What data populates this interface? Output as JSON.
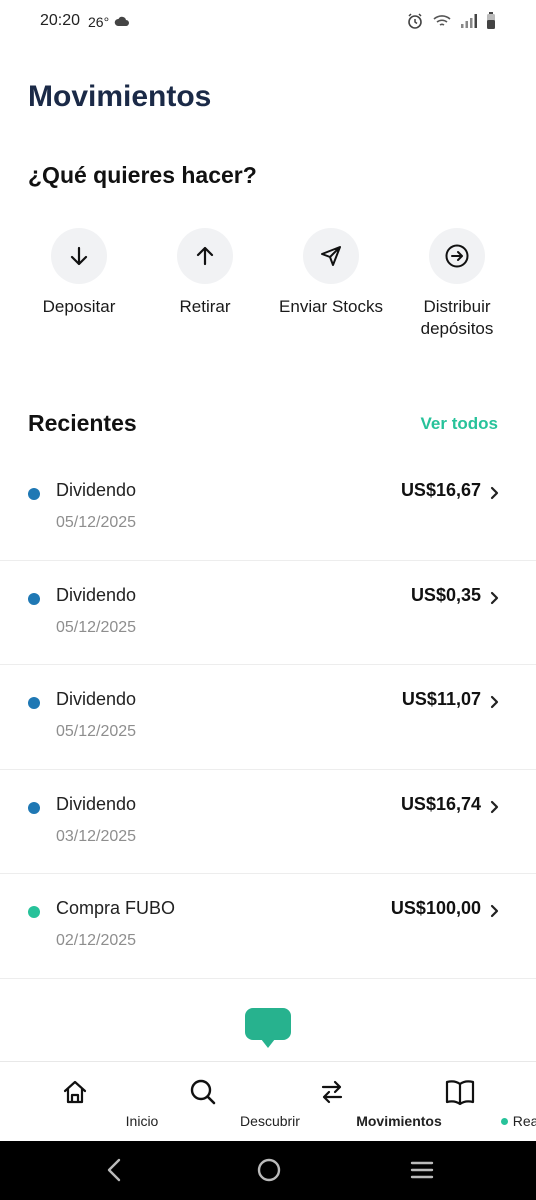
{
  "status_bar": {
    "time": "20:20",
    "temperature": "26°"
  },
  "page": {
    "title": "Movimientos",
    "question": "¿Qué quieres hacer?"
  },
  "actions": [
    {
      "label": "Depositar",
      "icon": "arrow-down-icon"
    },
    {
      "label": "Retirar",
      "icon": "arrow-up-icon"
    },
    {
      "label": "Enviar Stocks",
      "icon": "send-icon"
    },
    {
      "label": "Distribuir depósitos",
      "icon": "arrow-circle-right-icon"
    }
  ],
  "recent": {
    "title": "Recientes",
    "see_all": "Ver todos",
    "items": [
      {
        "name": "Dividendo",
        "date": "05/12/2025",
        "amount": "US$16,67",
        "dot_color": "#1f78b4"
      },
      {
        "name": "Dividendo",
        "date": "05/12/2025",
        "amount": "US$0,35",
        "dot_color": "#1f78b4"
      },
      {
        "name": "Dividendo",
        "date": "05/12/2025",
        "amount": "US$11,07",
        "dot_color": "#1f78b4"
      },
      {
        "name": "Dividendo",
        "date": "03/12/2025",
        "amount": "US$16,74",
        "dot_color": "#1f78b4"
      },
      {
        "name": "Compra FUBO",
        "date": "02/12/2025",
        "amount": "US$100,00",
        "dot_color": "#27c29a"
      }
    ]
  },
  "bottom_nav": [
    {
      "label": "Inicio",
      "icon": "home-icon"
    },
    {
      "label": "Descubrir",
      "icon": "search-icon"
    },
    {
      "label": "Movimientos",
      "icon": "transfer-icon",
      "active": true
    },
    {
      "label": "Reads",
      "icon": "book-icon"
    }
  ],
  "colors": {
    "accent": "#27c29a",
    "title": "#1b2a47",
    "chat": "#27b28e"
  }
}
